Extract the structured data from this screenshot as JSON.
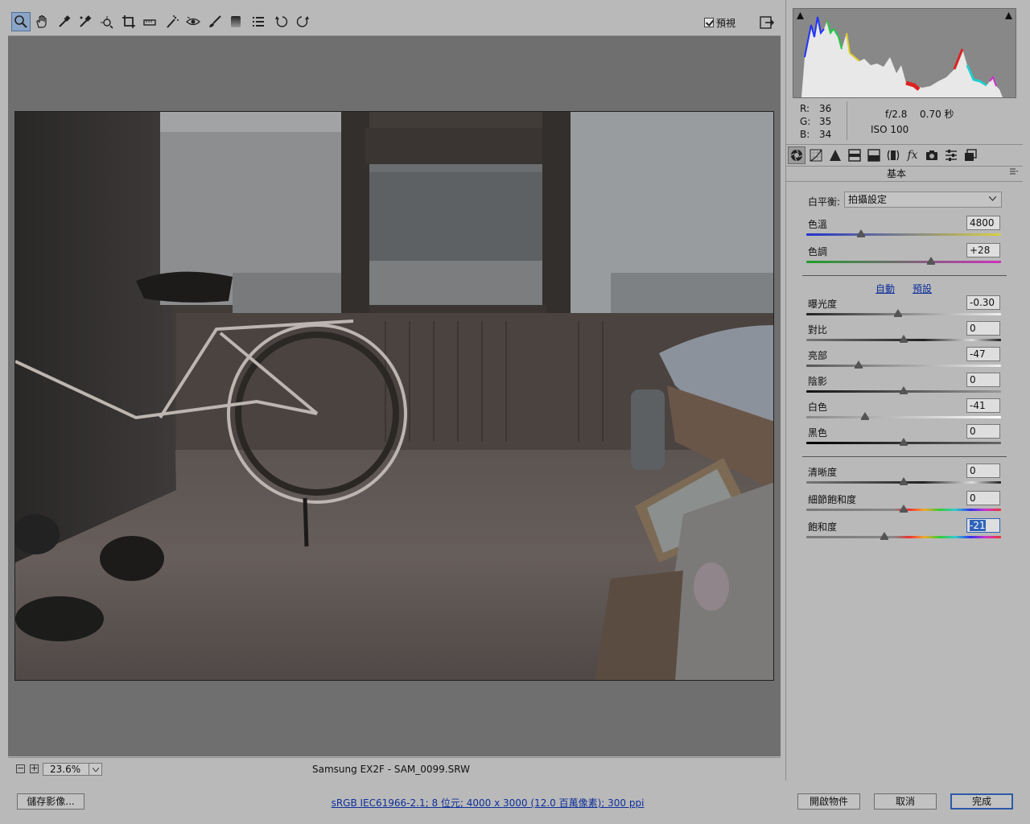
{
  "toolbar": {
    "tools": [
      "zoom-tool-icon",
      "hand-tool-icon",
      "white-balance-tool-icon",
      "color-sampler-tool-icon",
      "targeted-adjustment-tool-icon",
      "crop-tool-icon",
      "straighten-tool-icon",
      "spot-removal-tool-icon",
      "red-eye-removal-tool-icon",
      "adjustment-brush-icon",
      "graduated-filter-icon",
      "open-preferences-icon",
      "rotate-left-icon",
      "rotate-right-icon"
    ],
    "preview_label": "預視",
    "preview_checked": true
  },
  "status": {
    "zoom_value": "23.6%",
    "filename": "Samsung EX2F  -  SAM_0099.SRW"
  },
  "readout": {
    "r_label": "R:",
    "r": "36",
    "g_label": "G:",
    "g": "35",
    "b_label": "B:",
    "b": "34",
    "aperture": "f/2.8",
    "shutter": "0.70 秒",
    "iso": "ISO 100"
  },
  "panel": {
    "title": "基本",
    "wb_label": "白平衡:",
    "wb_value": "拍攝設定",
    "temp_label": "色溫",
    "temp_value": "4800",
    "temp_pos": 0.28,
    "tint_label": "色調",
    "tint_value": "+28",
    "tint_pos": 0.64,
    "auto_label": "自動",
    "default_label": "預設",
    "exposure_label": "曝光度",
    "exposure_value": "-0.30",
    "exposure_pos": 0.47,
    "contrast_label": "對比",
    "contrast_value": "0",
    "contrast_pos": 0.5,
    "highlights_label": "亮部",
    "highlights_value": "-47",
    "highlights_pos": 0.27,
    "shadows_label": "陰影",
    "shadows_value": "0",
    "shadows_pos": 0.5,
    "whites_label": "白色",
    "whites_value": "-41",
    "whites_pos": 0.3,
    "blacks_label": "黑色",
    "blacks_value": "0",
    "blacks_pos": 0.5,
    "clarity_label": "清晰度",
    "clarity_value": "0",
    "clarity_pos": 0.5,
    "vibrance_label": "細節飽和度",
    "vibrance_value": "0",
    "vibrance_pos": 0.5,
    "saturation_label": "飽和度",
    "saturation_value": "-21",
    "saturation_pos": 0.4
  },
  "bottom": {
    "save_label": "儲存影像...",
    "workflow_info": "sRGB IEC61966-2.1; 8 位元; 4000 x 3000 (12.0 百萬像素); 300 ppi",
    "open_label": "開啟物件",
    "cancel_label": "取消",
    "done_label": "完成"
  }
}
